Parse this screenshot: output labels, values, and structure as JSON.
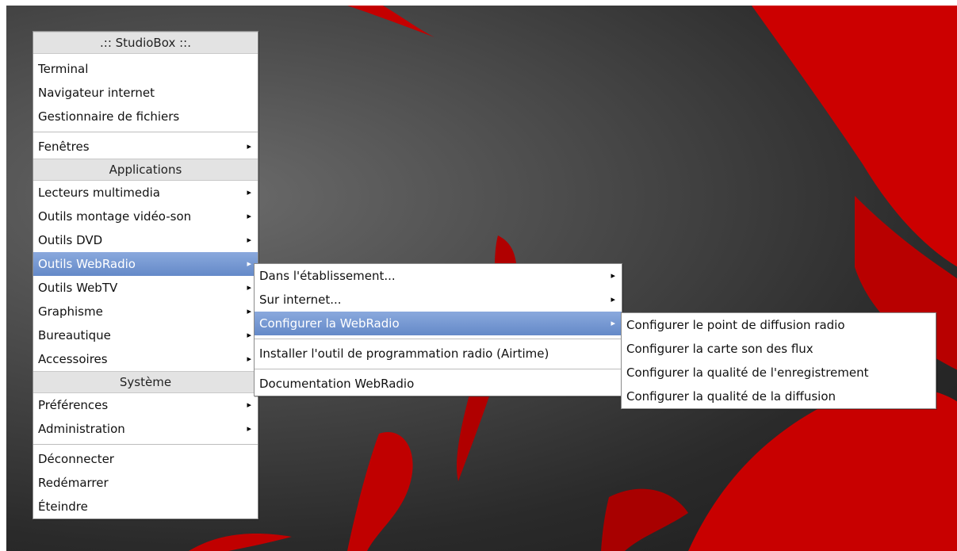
{
  "main_menu": {
    "title": ".:: StudioBox ::.",
    "items_top": [
      "Terminal",
      "Navigateur internet",
      "Gestionnaire de fichiers"
    ],
    "windows_item": "Fenêtres",
    "applications_header": "Applications",
    "applications": [
      "Lecteurs multimedia",
      "Outils montage vidéo-son",
      "Outils DVD",
      "Outils WebRadio",
      "Outils WebTV",
      "Graphisme",
      "Bureautique",
      "Accessoires"
    ],
    "system_header": "Système",
    "system": [
      "Préférences",
      "Administration"
    ],
    "session": [
      "Déconnecter",
      "Redémarrer",
      "Éteindre"
    ]
  },
  "webradio_menu": {
    "items": [
      "Dans l'établissement...",
      "Sur internet...",
      "Configurer la WebRadio",
      "Installer l'outil de programmation radio (Airtime)",
      "Documentation WebRadio"
    ]
  },
  "configure_menu": {
    "items": [
      "Configurer le point de diffusion radio",
      "Configurer la carte son des flux",
      "Configurer la qualité de l'enregistrement",
      "Configurer la qualité de la diffusion"
    ]
  },
  "icons": {
    "submenu_arrow": "▸"
  },
  "colors": {
    "highlight": "#6e8fcc",
    "wallpaper_accent": "#d00000"
  }
}
